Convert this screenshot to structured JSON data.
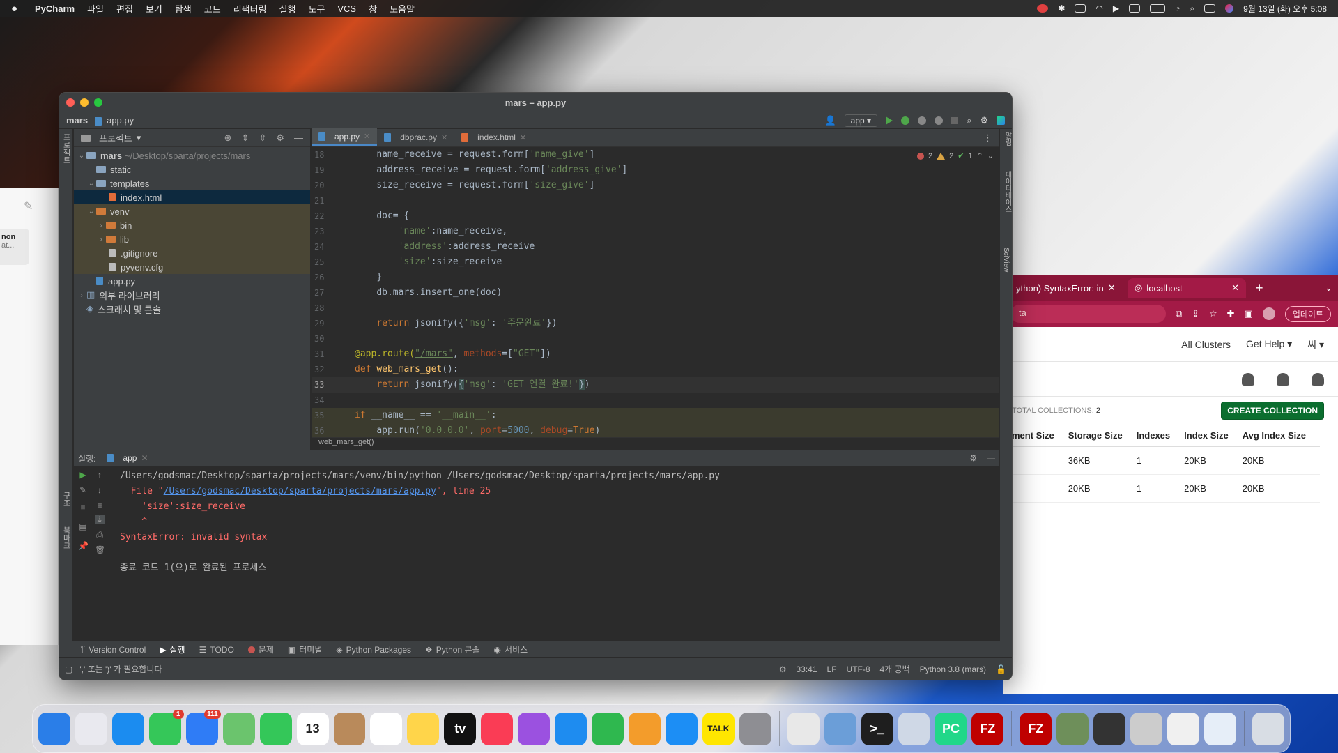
{
  "menubar": {
    "app": "PyCharm",
    "items": [
      "파일",
      "편집",
      "보기",
      "탐색",
      "코드",
      "리팩터링",
      "실행",
      "도구",
      "VCS",
      "창",
      "도움말"
    ],
    "clock": "9월 13일 (화) 오후 5:08"
  },
  "browser": {
    "tabs": [
      {
        "label": "ython) SyntaxError: in"
      },
      {
        "label": "localhost"
      }
    ],
    "url": "ta",
    "update_label": "업데이트",
    "nav": {
      "clusters": "All Clusters",
      "help": "Get Help",
      "user": "씨"
    },
    "collections": {
      "label": "TOTAL COLLECTIONS:",
      "count": "2"
    },
    "create_button": "CREATE COLLECTION",
    "table": {
      "headers": [
        "ment Size",
        "Storage Size",
        "Indexes",
        "Index Size",
        "Avg Index Size"
      ],
      "rows": [
        [
          "",
          "36KB",
          "1",
          "20KB",
          "20KB"
        ],
        [
          "",
          "20KB",
          "1",
          "20KB",
          "20KB"
        ]
      ]
    }
  },
  "leftwin": {
    "card_title": "non",
    "card_sub": "at..."
  },
  "ide": {
    "title": "mars – app.py",
    "nav": {
      "project": "mars",
      "file": "app.py",
      "run_config": "app"
    },
    "project_panel": {
      "title": "프로젝트",
      "root": {
        "name": "mars",
        "path": "~/Desktop/sparta/projects/mars"
      },
      "items": [
        "static",
        "templates",
        "index.html",
        "venv",
        "bin",
        "lib",
        ".gitignore",
        "pyvenv.cfg",
        "app.py",
        "외부 라이브러리",
        "스크래치 및 콘솔"
      ]
    },
    "editor_tabs": [
      "app.py",
      "dbprac.py",
      "index.html"
    ],
    "inspections": {
      "errors": "2",
      "warnings": "2",
      "ok": "1"
    },
    "line_numbers": [
      "18",
      "19",
      "20",
      "21",
      "22",
      "23",
      "24",
      "25",
      "26",
      "27",
      "28",
      "29",
      "30",
      "31",
      "32",
      "33",
      "34",
      "35",
      "36"
    ],
    "code": {
      "l18": [
        "name_receive = request.form[",
        "'name_give'",
        "]"
      ],
      "l19": [
        "address_receive = request.form[",
        "'address_give'",
        "]"
      ],
      "l20": [
        "size_receive = request.form[",
        "'size_give'",
        "]"
      ],
      "l22": "doc= {",
      "l23": [
        "'name'",
        ":name_receive,"
      ],
      "l24": [
        "'address'",
        ":address_receive"
      ],
      "l25": [
        "'size'",
        ":size_receive"
      ],
      "l26": "}",
      "l27": "db.mars.insert_one(doc)",
      "l29": [
        "return",
        " jsonify({",
        "'msg'",
        ": ",
        "'주문완료'",
        "})"
      ],
      "l31": [
        "@app.route(",
        "\"/mars\"",
        ", ",
        "methods",
        "=[",
        "\"GET\"",
        "])"
      ],
      "l32": [
        "def",
        " ",
        "web_mars_get",
        "():"
      ],
      "l33": [
        "return",
        " jsonify(",
        "{",
        "'msg'",
        ": ",
        "'GET 연결 완료!'",
        "}",
        ")"
      ],
      "l35": [
        "if",
        " __name__ == ",
        "'__main__'",
        ":"
      ],
      "l36": [
        "app.run(",
        "'0.0.0.0'",
        ", ",
        "port",
        "=",
        "5000",
        ", ",
        "debug",
        "=",
        "True",
        ")"
      ]
    },
    "breadcrumb": "web_mars_get()",
    "run": {
      "label": "실행:",
      "tab": "app",
      "lines": {
        "cmd": "/Users/godsmac/Desktop/sparta/projects/mars/venv/bin/python /Users/godsmac/Desktop/sparta/projects/mars/app.py",
        "file_prefix": "  File \"",
        "file_link": "/Users/godsmac/Desktop/sparta/projects/mars/app.py",
        "file_suffix": "\", line 25",
        "src": "    'size':size_receive",
        "caret": "    ^",
        "error": "SyntaxError: invalid syntax",
        "exit": "종료 코드 1(으)로 완료된 프로세스"
      }
    },
    "toolwindows": [
      "Version Control",
      "실행",
      "TODO",
      "문제",
      "터미널",
      "Python Packages",
      "Python 콘솔",
      "서비스"
    ],
    "status": {
      "message": "',' 또는 ')' 가 필요합니다",
      "position": "33:41",
      "line_sep": "LF",
      "encoding": "UTF-8",
      "indent": "4개 공백",
      "interpreter": "Python 3.8 (mars)"
    },
    "left_strip": [
      "프로젝트",
      "구조",
      "북마크"
    ],
    "right_strip": [
      "알림",
      "데이터베이스",
      "SciView"
    ]
  },
  "dock": {
    "apps": [
      {
        "name": "Finder",
        "color": "#2a7ee8"
      },
      {
        "name": "Launchpad",
        "color": "#e9e9ef"
      },
      {
        "name": "Safari",
        "color": "#1b8cf0"
      },
      {
        "name": "Messages",
        "color": "#35c759",
        "badge": "1"
      },
      {
        "name": "Mail",
        "color": "#2f7cf6",
        "badge": "111"
      },
      {
        "name": "Maps",
        "color": "#6bc46d"
      },
      {
        "name": "FaceTime",
        "color": "#34c759"
      },
      {
        "name": "Calendar",
        "color": "#ffffff",
        "label": "13"
      },
      {
        "name": "Contacts",
        "color": "#b98a5b"
      },
      {
        "name": "Reminders",
        "color": "#ffffff"
      },
      {
        "name": "Notes",
        "color": "#ffd54a"
      },
      {
        "name": "TV",
        "color": "#111111",
        "label": "tv"
      },
      {
        "name": "Music",
        "color": "#fa3c55"
      },
      {
        "name": "Podcasts",
        "color": "#9b51e0"
      },
      {
        "name": "Keynote",
        "color": "#1e8cf0"
      },
      {
        "name": "Numbers",
        "color": "#2fb84f"
      },
      {
        "name": "Pages",
        "color": "#f39c2b"
      },
      {
        "name": "App Store",
        "color": "#1c8ef5"
      },
      {
        "name": "KakaoTalk",
        "color": "#ffe600",
        "label": "TALK"
      },
      {
        "name": "System Preferences",
        "color": "#8e8e93"
      },
      {
        "name": "Chrome",
        "color": "#e8e8e8"
      },
      {
        "name": "Preview",
        "color": "#6b9ed8"
      },
      {
        "name": "Terminal",
        "color": "#1e1e1e",
        "label": ">_"
      },
      {
        "name": "Rocket",
        "color": "#cfd8e6"
      },
      {
        "name": "PyCharm",
        "color": "#21d789",
        "label": "PC"
      },
      {
        "name": "FileZilla",
        "color": "#bf0000",
        "label": "FZ"
      },
      {
        "name": "FileZilla 2",
        "color": "#bf0000",
        "label": "FZ"
      },
      {
        "name": "Window 1",
        "color": "#6e8f5a"
      },
      {
        "name": "Window 2",
        "color": "#333333"
      },
      {
        "name": "Window 3",
        "color": "#cccccc"
      },
      {
        "name": "Window 4",
        "color": "#f0f0f0"
      },
      {
        "name": "Window 5",
        "color": "#e6eef8"
      },
      {
        "name": "Trash",
        "color": "#d8dde4"
      }
    ]
  }
}
